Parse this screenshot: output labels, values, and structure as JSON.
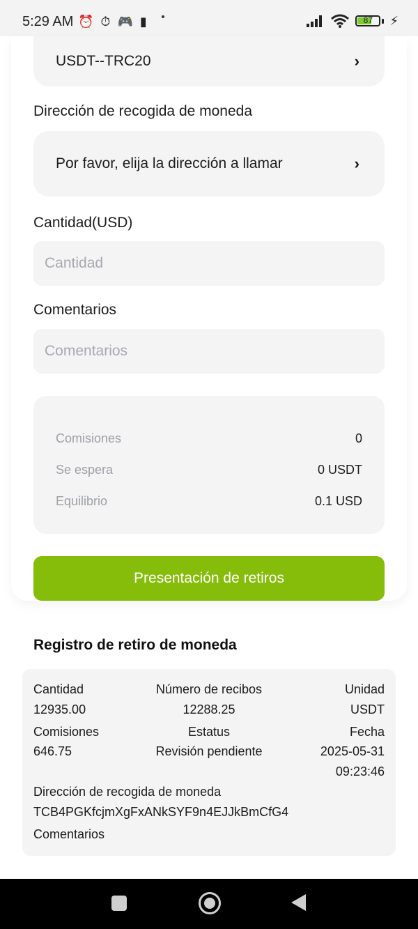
{
  "status_bar": {
    "time": "5:29 AM",
    "battery": "87"
  },
  "form": {
    "network_select": {
      "label": "USDT--TRC20",
      "chevron": "›"
    },
    "address": {
      "title": "Dirección de recogida de moneda",
      "select_label": "Por favor, elija la dirección a llamar",
      "chevron": "›"
    },
    "amount": {
      "title": "Cantidad(USD)",
      "placeholder": "Cantidad"
    },
    "comments": {
      "title": "Comentarios",
      "placeholder": "Comentarios"
    },
    "summary": {
      "fees_label": "Comisiones",
      "fees_value": "0",
      "expected_label": "Se espera",
      "expected_value": "0 USDT",
      "balance_label": "Equilibrio",
      "balance_value": "0.1 USD"
    },
    "submit_label": "Presentación de retiros"
  },
  "records": {
    "title": "Registro de retiro de moneda",
    "headers": {
      "amount": "Cantidad",
      "receipts": "Número de recibos",
      "unit": "Unidad",
      "fees": "Comisiones",
      "status": "Estatus",
      "date": "Fecha",
      "address": "Dirección de recogida de moneda",
      "comments": "Comentarios"
    },
    "item": {
      "amount": "12935.00",
      "receipts": "12288.25",
      "unit": "USDT",
      "fees": "646.75",
      "status": "Revisión pendiente",
      "date": "2025-05-31",
      "time": "09:23:46",
      "address": "TCB4PGKfcjmXgFxANkSYF9n4EJJkBmCfG4"
    }
  },
  "colors": {
    "accent": "#86bc0a",
    "field_bg": "#f4f4f4",
    "muted": "#9ea0a6"
  }
}
